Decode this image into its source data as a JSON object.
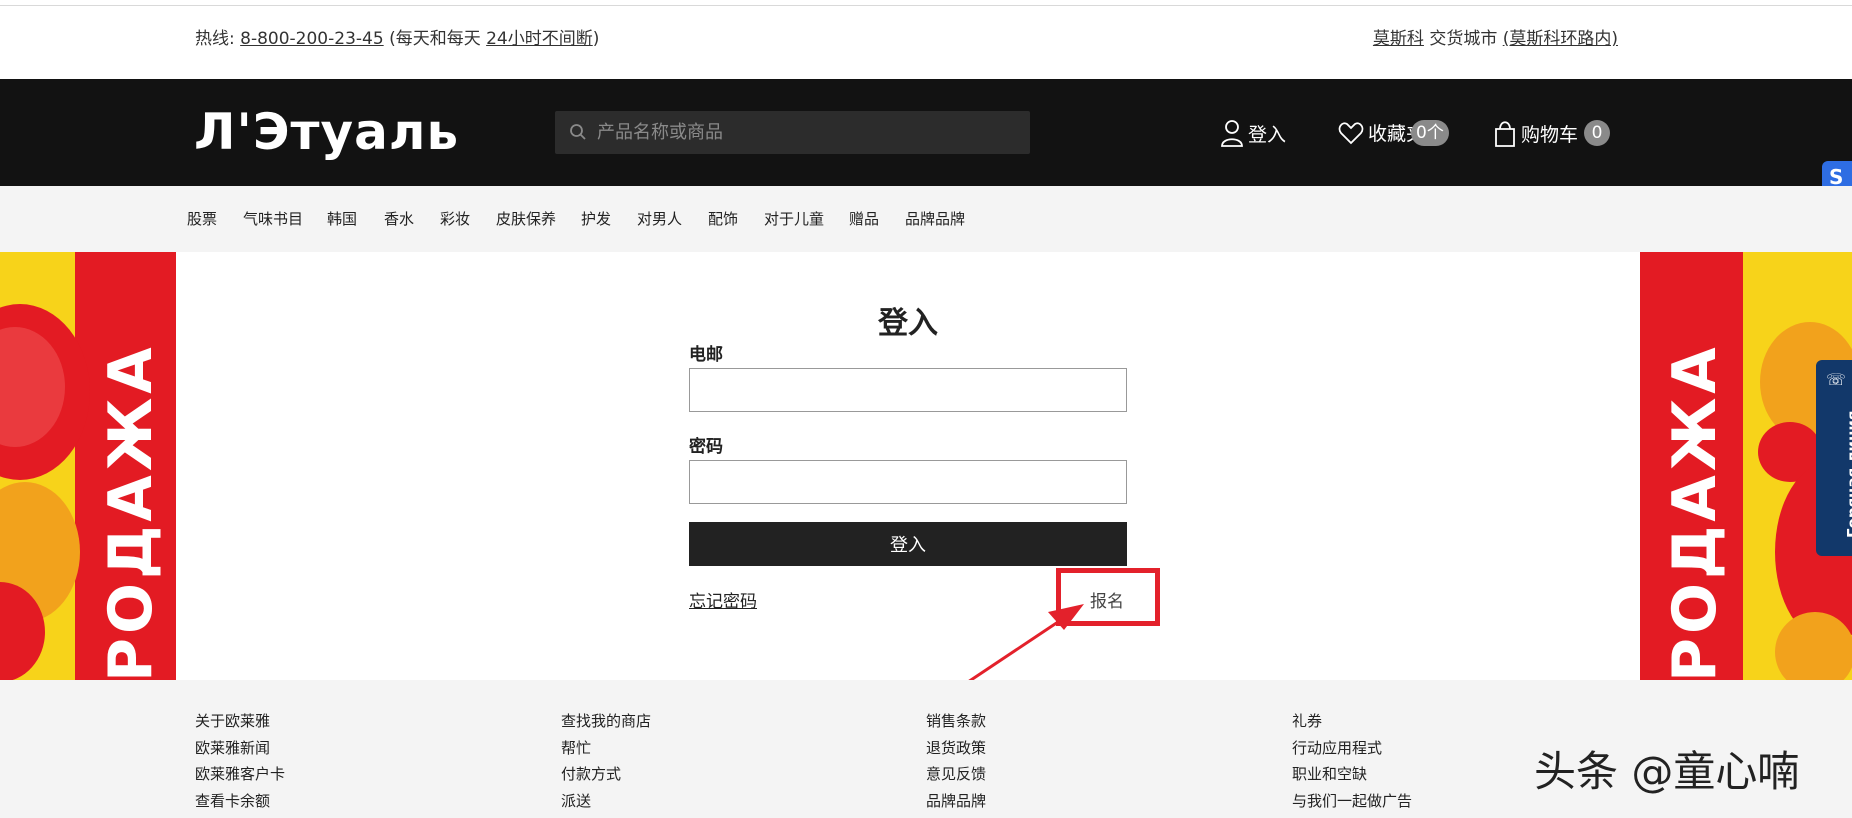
{
  "topbar": {
    "hotline_label": "热线:",
    "hotline_number": "8-800-200-23-45",
    "hotline_hours_prefix": "(每天和每天",
    "hotline_hours": "24小时不间断",
    "hotline_hours_suffix": ")",
    "city": "莫斯科",
    "delivery_label": "交货城市",
    "delivery_region": "(莫斯科环路内)"
  },
  "header": {
    "logo_text": "Л'Этуаль",
    "search_placeholder": "产品名称或商品",
    "login_label": "登入",
    "favorites_label": "收藏夹",
    "favorites_count": "0个",
    "cart_label": "购物车",
    "cart_count": "0"
  },
  "side_badge": "S",
  "categories": [
    "股票",
    "气味书目",
    "韩国",
    "香水",
    "彩妆",
    "皮肤保养",
    "护发",
    "对男人",
    "配饰",
    "对于儿童",
    "赠品",
    "品牌品牌"
  ],
  "banner_text": "РОДАЖА",
  "login_form": {
    "title": "登入",
    "email_label": "电邮",
    "email_value": "",
    "password_label": "密码",
    "password_value": "",
    "submit_label": "登入",
    "forgot_label": "忘记密码",
    "register_label": "报名"
  },
  "footer": {
    "col1": [
      "关于欧莱雅",
      "欧莱雅新闻",
      "欧莱雅客户卡",
      "查看卡余额"
    ],
    "col2": [
      "查找我的商店",
      "帮忙",
      "付款方式",
      "派送"
    ],
    "col3": [
      "销售条款",
      "退货政策",
      "意见反馈",
      "品牌品牌"
    ],
    "col4": [
      "礼券",
      "行动应用程式",
      "职业和空缺",
      "与我们一起做广告"
    ]
  },
  "hotline_tab": "Горячая линия",
  "watermark": "头条 @童心喃",
  "colors": {
    "header_bg": "#121212",
    "accent_red": "#e3212b",
    "banner_yellow": "#f7d31a",
    "hotline_tab": "#12386a"
  }
}
